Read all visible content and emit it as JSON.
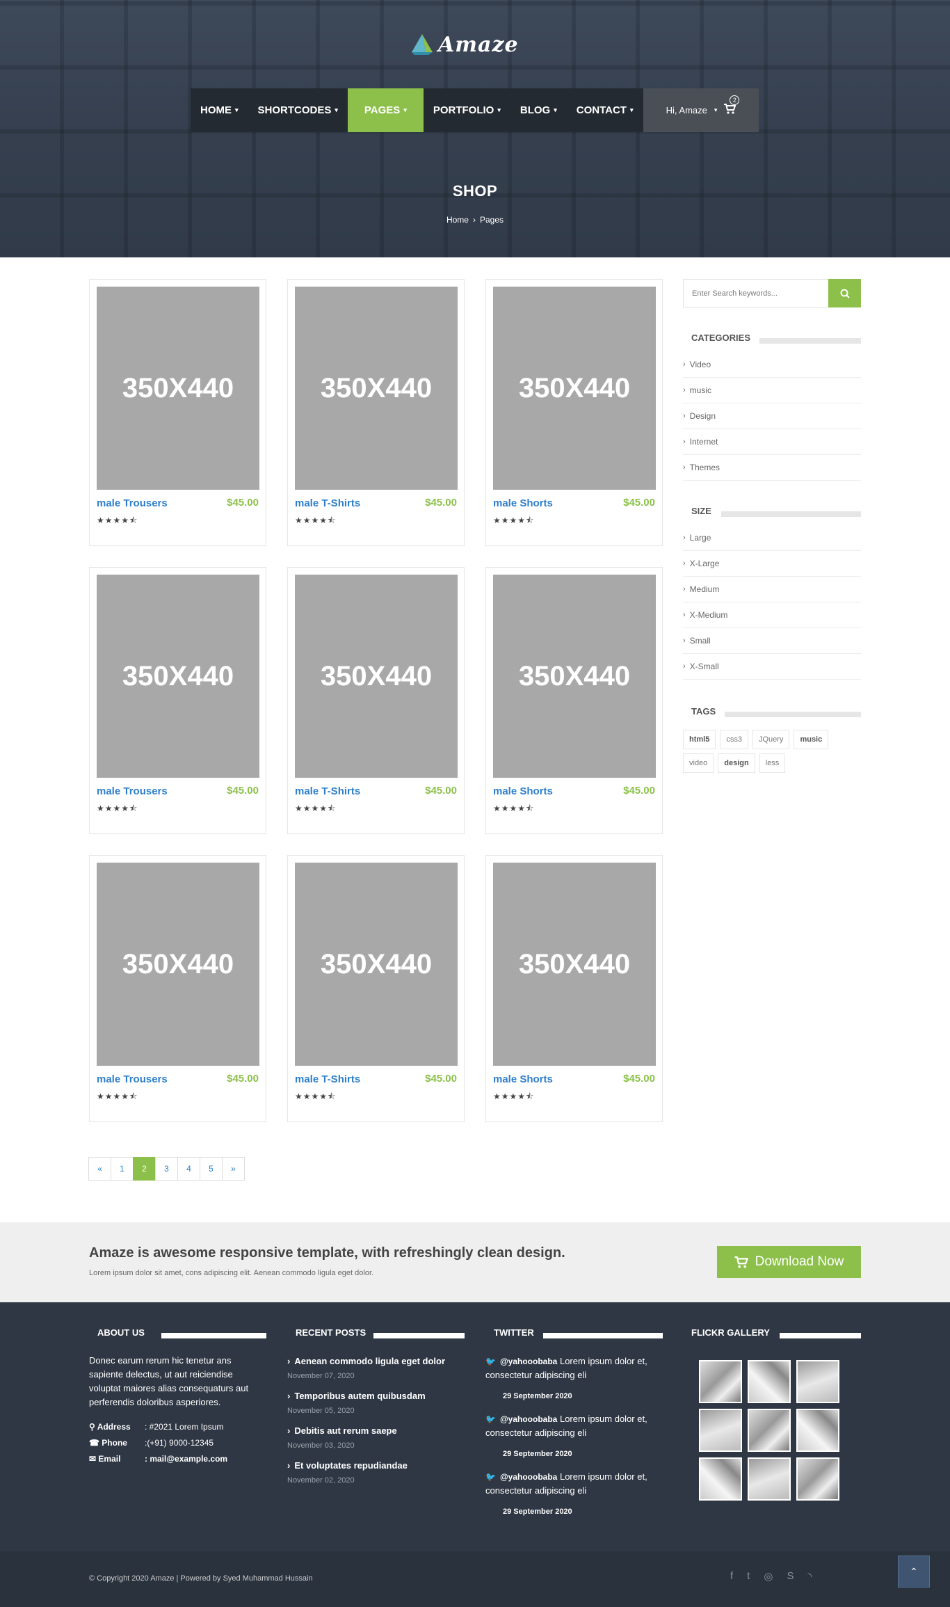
{
  "brand": {
    "name": "Amaze",
    "accent": "#8cc04a",
    "link": "#2f7fc9"
  },
  "nav": {
    "items": [
      {
        "label": "HOME",
        "caret": "▾"
      },
      {
        "label": "SHORTCODES",
        "caret": "▾"
      },
      {
        "label": "PAGES",
        "caret": "▾",
        "active": true
      },
      {
        "label": "PORTFOLIO",
        "caret": "▾"
      },
      {
        "label": "BLOG",
        "caret": "▾"
      },
      {
        "label": "CONTACT",
        "caret": "▾"
      }
    ],
    "user_label": "Hi, Amaze",
    "user_caret": "▾",
    "cart_count": "2",
    "cart_icon": "cart-icon"
  },
  "hero": {
    "title": "SHOP",
    "breadcrumb": [
      "Home",
      "Pages"
    ],
    "breadcrumb_sep": "›"
  },
  "products": [
    {
      "image": "350X440",
      "name": "male Trousers",
      "price": "$45.00",
      "rating": 4.5
    },
    {
      "image": "350X440",
      "name": "male T-Shirts",
      "price": "$45.00",
      "rating": 4.5
    },
    {
      "image": "350X440",
      "name": "male Shorts",
      "price": "$45.00",
      "rating": 4.5
    },
    {
      "image": "350X440",
      "name": "male Trousers",
      "price": "$45.00",
      "rating": 4.5
    },
    {
      "image": "350X440",
      "name": "male T-Shirts",
      "price": "$45.00",
      "rating": 4.5
    },
    {
      "image": "350X440",
      "name": "male Shorts",
      "price": "$45.00",
      "rating": 4.5
    },
    {
      "image": "350X440",
      "name": "male Trousers",
      "price": "$45.00",
      "rating": 4.5
    },
    {
      "image": "350X440",
      "name": "male T-Shirts",
      "price": "$45.00",
      "rating": 4.5
    },
    {
      "image": "350X440",
      "name": "male Shorts",
      "price": "$45.00",
      "rating": 4.5
    }
  ],
  "pagination": {
    "prev": "«",
    "pages": [
      "1",
      "2",
      "3",
      "4",
      "5"
    ],
    "next": "»",
    "current": "2"
  },
  "sidebar": {
    "search_placeholder": "Enter Search keywords...",
    "categories_title": "CATEGORIES",
    "categories": [
      "Video",
      "music",
      "Design",
      "Internet",
      "Themes"
    ],
    "size_title": "SIZE",
    "sizes": [
      "Large",
      "X-Large",
      "Medium",
      "X-Medium",
      "Small",
      "X-Small"
    ],
    "tags_title": "TAGS",
    "tags": [
      "html5",
      "css3",
      "JQuery",
      "music",
      "video",
      "design",
      "less"
    ]
  },
  "cta": {
    "heading": "Amaze is awesome responsive template, with refreshingly clean design.",
    "text": "Lorem ipsum dolor sit amet, cons adipiscing elit. Aenean commodo ligula eget dolor.",
    "button": "Download Now"
  },
  "footer": {
    "about_title": "ABOUT US",
    "about_text": "Donec earum rerum hic tenetur ans sapiente delectus, ut aut reiciendise voluptat maiores alias consequaturs aut perferendis doloribus asperiores.",
    "contact": [
      {
        "label": "Address",
        "value": ": #2021 Lorem Ipsum",
        "icon": "map-pin-icon"
      },
      {
        "label": "Phone",
        "value": ":(+91) 9000-12345",
        "icon": "phone-icon"
      },
      {
        "label": "Email",
        "value": ": mail@example.com",
        "icon": "envelope-icon"
      }
    ],
    "recent_title": "RECENT POSTS",
    "posts": [
      {
        "title": "Aenean commodo ligula eget dolor",
        "date": "November 07, 2020"
      },
      {
        "title": "Temporibus autem quibusdam",
        "date": "November 05, 2020"
      },
      {
        "title": "Debitis aut rerum saepe",
        "date": "November 03, 2020"
      },
      {
        "title": "Et voluptates repudiandae",
        "date": "November 02, 2020"
      }
    ],
    "twitter_title": "TWITTER",
    "tweets": [
      {
        "handle": "@yahooobaba",
        "text": "Lorem ipsum dolor et, consectetur adipiscing eli",
        "date": "29 September 2020"
      },
      {
        "handle": "@yahooobaba",
        "text": "Lorem ipsum dolor et, consectetur adipiscing eli",
        "date": "29 September 2020"
      },
      {
        "handle": "@yahooobaba",
        "text": "Lorem ipsum dolor et, consectetur adipiscing eli",
        "date": "29 September 2020"
      }
    ],
    "flickr_title": "FLICKR GALLERY",
    "copyright": "© Copyright 2020 Amaze | Powered by Syed Muhammad Hussain",
    "socials": [
      "facebook-icon",
      "twitter-icon",
      "dribbble-icon",
      "skype-icon",
      "rss-icon"
    ]
  }
}
